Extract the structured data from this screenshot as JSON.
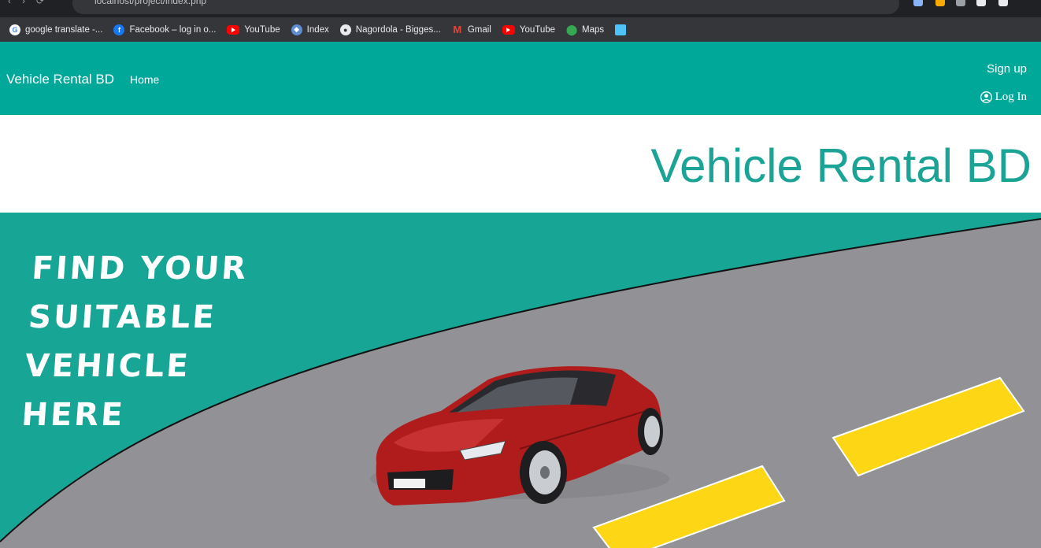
{
  "browser": {
    "address_url": "localhost/project/index.php",
    "bookmarks": [
      {
        "label": "google translate -...",
        "icon": "google-icon"
      },
      {
        "label": "Facebook – log in o...",
        "icon": "facebook-icon"
      },
      {
        "label": "YouTube",
        "icon": "youtube-icon"
      },
      {
        "label": "Index",
        "icon": "index-icon"
      },
      {
        "label": "Nagordola - Bigges...",
        "icon": "globe-icon"
      },
      {
        "label": "Gmail",
        "icon": "gmail-icon"
      },
      {
        "label": "YouTube",
        "icon": "youtube-icon"
      },
      {
        "label": "Maps",
        "icon": "maps-icon"
      },
      {
        "label": "",
        "icon": "image-icon"
      }
    ]
  },
  "nav": {
    "brand": "Vehicle Rental BD",
    "home": "Home",
    "signup": "Sign up",
    "login": "Log In"
  },
  "hero": {
    "title": "Vehicle Rental BD",
    "tagline": [
      "Find your",
      "Suitable",
      "Vehicle",
      "Here"
    ]
  },
  "colors": {
    "nav_bg": "#00a89a",
    "title_text": "#1ba496",
    "banner_teal": "#17a596",
    "road_gray": "#929296",
    "lane_yellow": "#fdd616",
    "car_red": "#b01c1c"
  }
}
